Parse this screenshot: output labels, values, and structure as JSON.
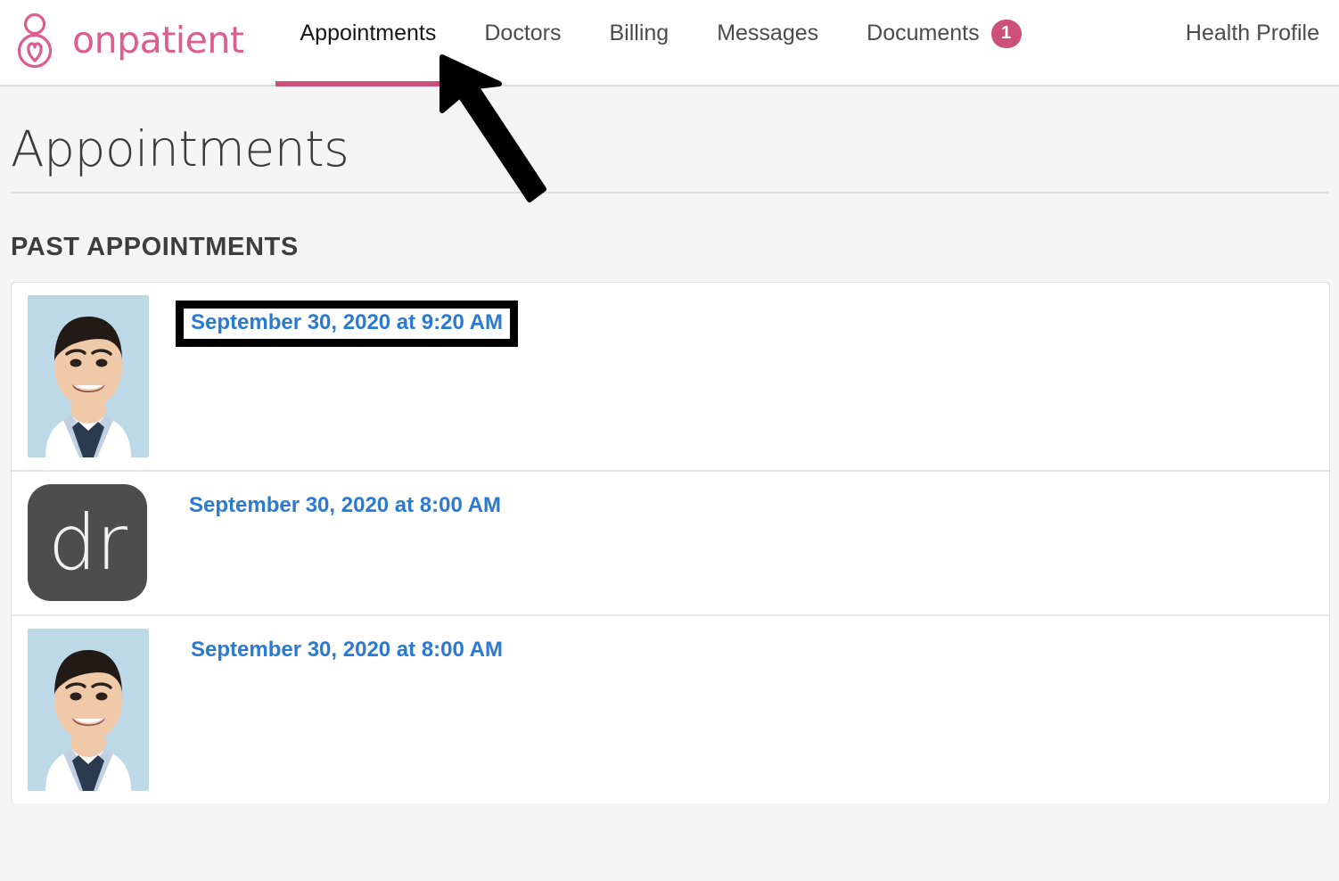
{
  "brand": {
    "name": "onpatient",
    "logo_icon": "person-heart-icon",
    "color": "#dc5d8e"
  },
  "nav": {
    "items": [
      {
        "label": "Appointments",
        "active": true,
        "badge": null
      },
      {
        "label": "Doctors",
        "active": false,
        "badge": null
      },
      {
        "label": "Billing",
        "active": false,
        "badge": null
      },
      {
        "label": "Messages",
        "active": false,
        "badge": null
      },
      {
        "label": "Documents",
        "active": false,
        "badge": "1"
      },
      {
        "label": "Health Profile",
        "active": false,
        "badge": null
      }
    ],
    "active_underline_color": "#cc5079",
    "badge_color": "#cc5079"
  },
  "page": {
    "title": "Appointments",
    "section_heading": "PAST APPOINTMENTS"
  },
  "appointments": [
    {
      "datetime_label": "September 30, 2020 at 9:20 AM",
      "avatar_type": "doctor-photo",
      "highlighted": true
    },
    {
      "datetime_label": "September 30, 2020 at 8:00 AM",
      "avatar_type": "dr-logo",
      "avatar_text": "dr",
      "highlighted": false
    },
    {
      "datetime_label": "September 30, 2020 at 8:00 AM",
      "avatar_type": "doctor-photo",
      "highlighted": false
    }
  ],
  "annotations": {
    "arrow_target": "Appointments",
    "link_color": "#2a7ad1",
    "highlight_border_color": "#000000"
  }
}
